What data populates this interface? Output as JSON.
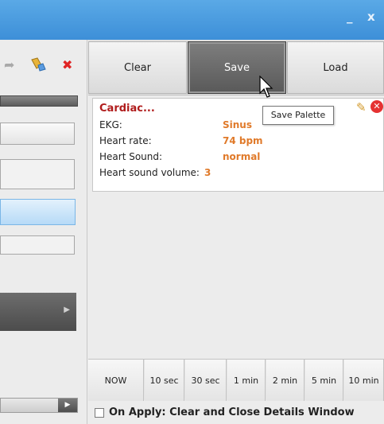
{
  "window": {
    "minimize_glyph": "_",
    "close_glyph": "x",
    "titlebar_color": "#4a9be0"
  },
  "toolbar": {
    "icons": [
      "redo-arrow-icon",
      "broom-icon",
      "delete-x-icon"
    ]
  },
  "palette_buttons": {
    "clear_label": "Clear",
    "save_label": "Save",
    "load_label": "Load"
  },
  "card": {
    "title": "Cardiac...",
    "rows": [
      {
        "label": "EKG:",
        "value": "Sinus"
      },
      {
        "label": "Heart rate:",
        "value": "74 bpm"
      },
      {
        "label": "Heart Sound:",
        "value": "normal"
      },
      {
        "label": "Heart sound volume:",
        "value": "3"
      }
    ],
    "title_color": "#b01c1c",
    "value_color": "#e07a2a"
  },
  "tooltip": {
    "text": "Save Palette"
  },
  "time_buttons": [
    "NOW",
    "10 sec",
    "30 sec",
    "1 min",
    "2 min",
    "5 min",
    "10 min"
  ],
  "apply_option": {
    "label": "On Apply: Clear and Close Details Window",
    "checked": false
  }
}
